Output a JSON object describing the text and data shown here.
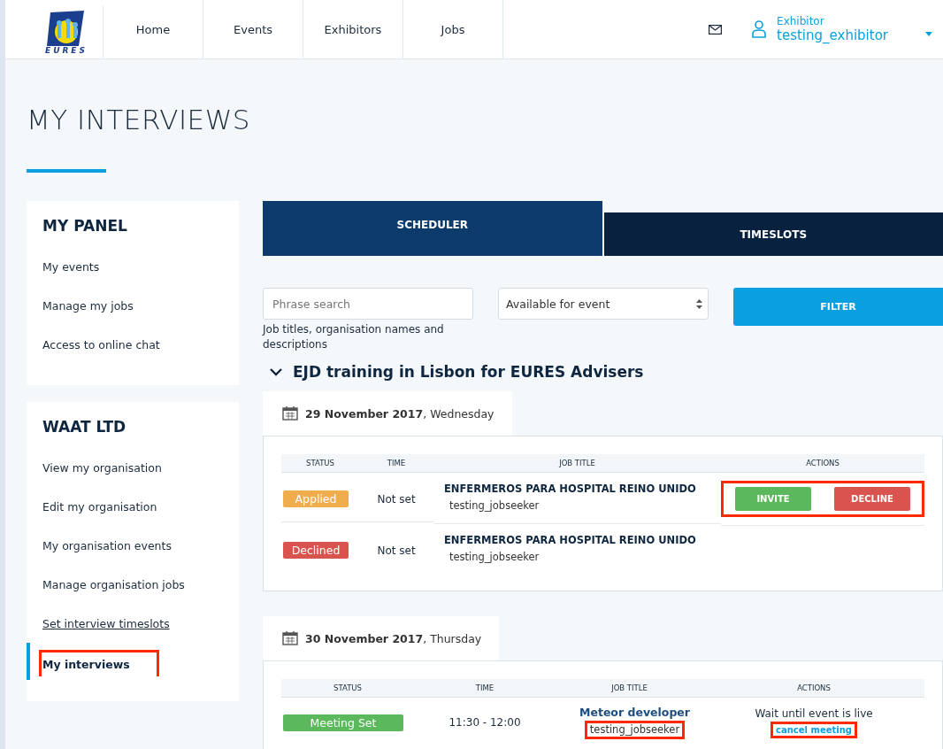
{
  "header": {
    "logo_text": "EURES",
    "nav": [
      {
        "label": "Home",
        "selected": false
      },
      {
        "label": "Events",
        "selected": false
      },
      {
        "label": "Exhibitors",
        "selected": false
      },
      {
        "label": "Jobs",
        "selected": false
      }
    ],
    "user": {
      "role": "Exhibitor",
      "name": "testing_exhibitor"
    }
  },
  "page_title": "MY INTERVIEWS",
  "sidebar": [
    {
      "title": "MY PANEL",
      "items": [
        {
          "label": "My events",
          "selected": false,
          "hovered": false,
          "highlighted": false
        },
        {
          "label": "Manage my jobs",
          "selected": false,
          "hovered": false,
          "highlighted": false
        },
        {
          "label": "Access to online chat",
          "selected": false,
          "hovered": false,
          "highlighted": false
        }
      ]
    },
    {
      "title": "WAAT LTD",
      "items": [
        {
          "label": "View my organisation",
          "selected": false,
          "hovered": false,
          "highlighted": false
        },
        {
          "label": "Edit my organisation",
          "selected": false,
          "hovered": false,
          "highlighted": false
        },
        {
          "label": "My organisation events",
          "selected": false,
          "hovered": false,
          "highlighted": false
        },
        {
          "label": "Manage organisation jobs",
          "selected": false,
          "hovered": false,
          "highlighted": false
        },
        {
          "label": "Set interview timeslots",
          "selected": false,
          "hovered": true,
          "highlighted": false
        },
        {
          "label": "My interviews",
          "selected": true,
          "hovered": false,
          "highlighted": true
        }
      ]
    }
  ],
  "tabs": [
    {
      "label": "SCHEDULER",
      "selected": true
    },
    {
      "label": "TIMESLOTS",
      "selected": false
    }
  ],
  "filters": {
    "search_placeholder": "Phrase search",
    "search_hint": "Job titles, organisation names and descriptions",
    "select_value": "Available for event",
    "button": "FILTER"
  },
  "event": {
    "title": "EJD training in Lisbon for EURES Advisers",
    "expanded": true
  },
  "days": [
    {
      "date": "29 November 2017",
      "weekday": ", Wednesday",
      "columns": [
        "STATUS",
        "TIME",
        "JOB TITLE",
        "ACTIONS"
      ],
      "rows": [
        {
          "status": "Applied",
          "color": "#f0ad4e",
          "time": "Not set",
          "job_title": "ENFERMEROS PARA HOSPITAL REINO UNIDO",
          "seeker": "testing_jobseeker",
          "seeker_highlighted": false,
          "actions": {
            "kind": "buttons",
            "highlighted": true,
            "buttons": [
              {
                "label": "INVITE",
                "kind": "accept"
              },
              {
                "label": "DECLINE",
                "kind": "reject"
              }
            ]
          }
        },
        {
          "status": "Declined",
          "color": "#d9534f",
          "time": "Not set",
          "job_title": "ENFERMEROS PARA HOSPITAL REINO UNIDO",
          "seeker": "testing_jobseeker",
          "seeker_highlighted": false,
          "actions": {
            "kind": "none"
          }
        }
      ]
    },
    {
      "date": "30 November 2017",
      "weekday": ", Thursday",
      "columns": [
        "STATUS",
        "TIME",
        "JOB TITLE",
        "ACTIONS"
      ],
      "rows": [
        {
          "status": "Meeting Set",
          "color": "#5cb85c",
          "time": "11:30 - 12:00",
          "job_title": "Meteor developer",
          "seeker": "testing_jobseeker",
          "seeker_highlighted": true,
          "actions": {
            "kind": "wait",
            "note": "Wait until event is live",
            "link": "cancel meeting",
            "link_highlighted": true
          }
        }
      ]
    }
  ]
}
